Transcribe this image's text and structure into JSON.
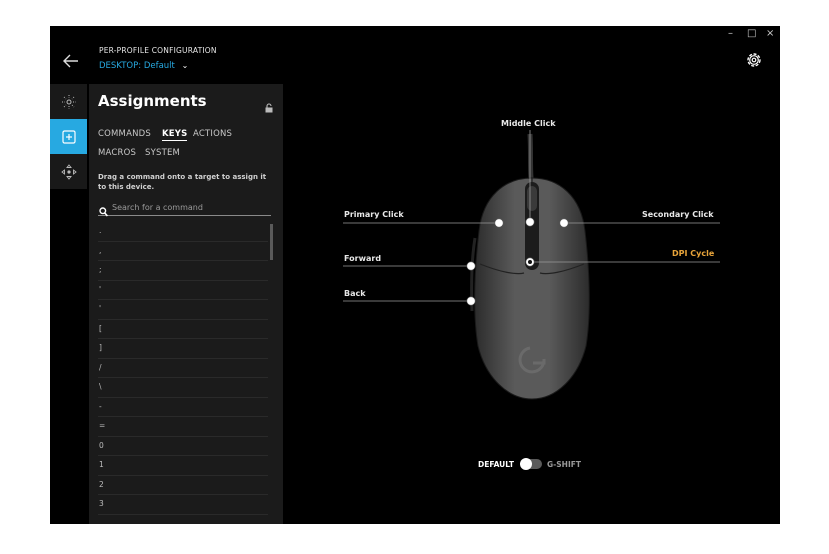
{
  "header": {
    "title": "PER-PROFILE CONFIGURATION",
    "profile_prefix": "DESKTOP:",
    "profile_value": "Default",
    "minimize": "–",
    "maximize": "□",
    "close": "×"
  },
  "panel": {
    "title": "Assignments",
    "tabs": [
      {
        "label": "COMMANDS",
        "active": false
      },
      {
        "label": "KEYS",
        "active": true
      },
      {
        "label": "ACTIONS",
        "active": false
      },
      {
        "label": "MACROS",
        "active": false
      },
      {
        "label": "SYSTEM",
        "active": false
      }
    ],
    "hint": "Drag a command onto a target to assign it to this device.",
    "search_placeholder": "Search for a command",
    "keys": [
      ".",
      ",",
      ";",
      "'",
      "'",
      "[",
      "]",
      "/",
      "\\",
      "-",
      "=",
      "0",
      "1",
      "2",
      "3"
    ]
  },
  "mouse": {
    "callouts": {
      "middle_click": "Middle Click",
      "primary_click": "Primary Click",
      "secondary_click": "Secondary Click",
      "forward": "Forward",
      "dpi_cycle": "DPI Cycle",
      "back": "Back"
    },
    "logo": "G"
  },
  "mode_toggle": {
    "left_label": "DEFAULT",
    "right_label": "G-SHIFT",
    "state": "default"
  },
  "colors": {
    "accent": "#27a9e1",
    "dpi_highlight": "#e8a43a",
    "background": "#000000",
    "panel": "#1b1b1b"
  }
}
